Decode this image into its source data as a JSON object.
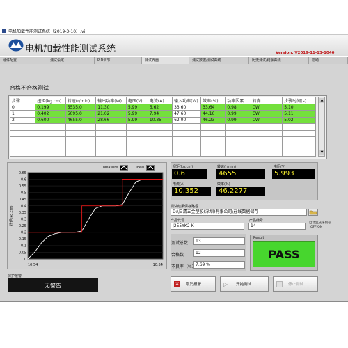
{
  "window": {
    "title": "电机加载性能测试系统（2019-3-10）.vi",
    "app_title": "电机加载性能测试系统",
    "version": "Version: V2019-11-13-1040"
  },
  "tabs": [
    {
      "label": "硬件配置"
    },
    {
      "label": "测试设定"
    },
    {
      "label": "PID调节"
    },
    {
      "label": "测试界面"
    },
    {
      "label": "测试数据/测试曲线"
    },
    {
      "label": "历史测试/结余曲线"
    },
    {
      "label": "帮助"
    }
  ],
  "section": {
    "title": "合格不合格测试"
  },
  "table": {
    "headers": [
      "步骤",
      "扭矩(kg.cm)",
      "转速(r/min)",
      "输出功率(W)",
      "电压(V)",
      "电流(A)",
      "输入功率(W)",
      "效率(%)",
      "功率因素",
      "转向",
      "步骤时间(s)"
    ],
    "rows": [
      [
        "0",
        "0.199",
        "5535.0",
        "11.30",
        "5.99",
        "5.62",
        "33.60",
        "33.64",
        "0.98",
        "CW",
        "5.10"
      ],
      [
        "1",
        "0.402",
        "5095.0",
        "21.02",
        "5.99",
        "7.94",
        "47.60",
        "44.16",
        "0.99",
        "CW",
        "5.11"
      ],
      [
        "2",
        "0.600",
        "4655.0",
        "28.66",
        "5.99",
        "10.35",
        "62.00",
        "46.23",
        "0.99",
        "CW",
        "5.02"
      ]
    ]
  },
  "graph": {
    "legend": [
      {
        "name": "Measure"
      },
      {
        "name": "Ideal"
      }
    ],
    "ylabel": "扭矩(kg.cm)",
    "yticks": [
      "0.65",
      "0.6",
      "0.55",
      "0.5",
      "0.45",
      "0.4",
      "0.35",
      "0.3",
      "0.25",
      "0.2",
      "0.15",
      "0.1",
      "0.05",
      "0"
    ],
    "xticks": [
      "10:54",
      "10:54"
    ]
  },
  "chart_data": {
    "type": "line",
    "ylim": [
      0,
      0.65
    ],
    "yticks": [
      0.65,
      0.6,
      0.55,
      0.5,
      0.45,
      0.4,
      0.35,
      0.3,
      0.25,
      0.2,
      0.15,
      0.1,
      0.05,
      0
    ],
    "xticks": [
      "10:54",
      "10:54"
    ],
    "ylabel": "扭矩(kg.cm)",
    "series": [
      {
        "name": "Measure",
        "color": "#ffffff",
        "y": [
          0.0,
          0.05,
          0.12,
          0.17,
          0.19,
          0.2,
          0.2,
          0.2,
          0.21,
          0.3,
          0.38,
          0.4,
          0.4,
          0.4,
          0.41,
          0.5,
          0.58,
          0.6,
          0.6,
          0.6,
          0.6
        ]
      },
      {
        "name": "Ideal",
        "color": "#e01818",
        "y": [
          0.2,
          0.2,
          0.2,
          0.2,
          0.2,
          0.2,
          0.2,
          0.2,
          0.4,
          0.4,
          0.4,
          0.4,
          0.4,
          0.4,
          0.6,
          0.6,
          0.6,
          0.6,
          0.6,
          0.6,
          0.6
        ]
      }
    ]
  },
  "readouts": {
    "torque": {
      "label": "扭矩(kg.cm)",
      "value": "0.6"
    },
    "speed": {
      "label": "转速(r/min)",
      "value": "4655"
    },
    "voltage": {
      "label": "电压(V)",
      "value": "5.993"
    },
    "current": {
      "label": "电流(A)",
      "value": "10.352"
    },
    "efficiency": {
      "label": "效率(%)",
      "value": "46.2277"
    }
  },
  "form": {
    "path_label": "测试结果保存路径",
    "path_value": "D:\\日清五金塑胶(深圳)有限公司\\在线数据储存",
    "product_code_label": "产品代号",
    "product_code_value": "J255YK2-K",
    "product_number_label": "产品编号",
    "product_number_value": "14",
    "auto_inc_label": "自动生成序列号",
    "auto_inc_option": "OFF/ON"
  },
  "stats": {
    "total_label": "测试总数",
    "total_value": "13",
    "pass_label": "合格数",
    "pass_value": "12",
    "fail_rate_label": "不良率（%）",
    "fail_rate_value": "7.69 %"
  },
  "result": {
    "label": "Result",
    "value": "PASS",
    "color": "#47d62e"
  },
  "alarm": {
    "label": "保护报警",
    "value": "无警告"
  },
  "buttons": {
    "cancel": "取消报警",
    "start": "开始测试",
    "stop": "停止测试"
  }
}
